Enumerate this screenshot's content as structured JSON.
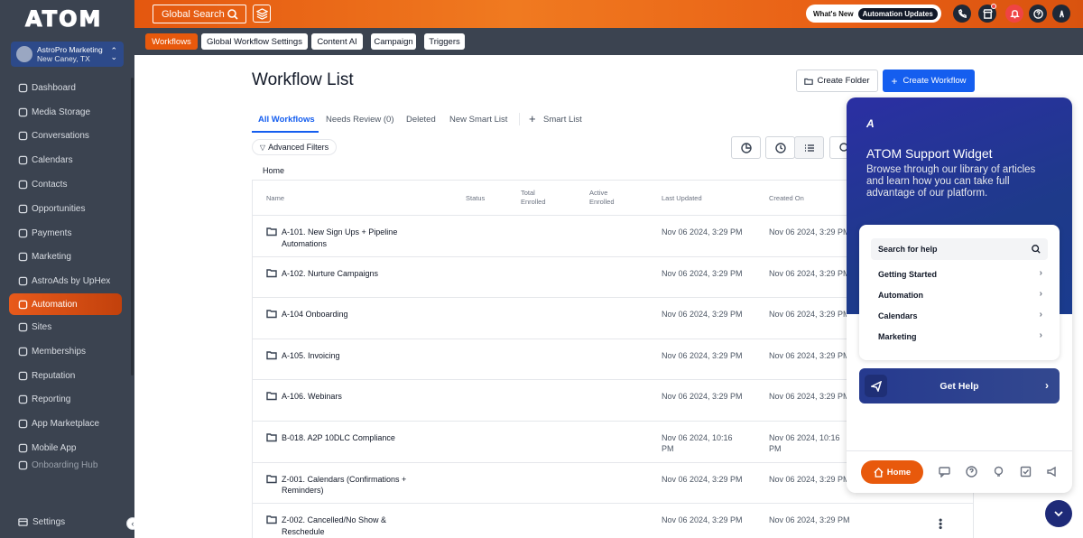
{
  "app": {
    "logo": "ATOM"
  },
  "account": {
    "name": "AstroPro Marketing",
    "location": "New Caney, TX"
  },
  "sidebar": {
    "items": [
      {
        "label": "Dashboard",
        "icon": "dashboard-icon"
      },
      {
        "label": "Media Storage",
        "icon": "media-icon"
      },
      {
        "label": "Conversations",
        "icon": "chat-icon"
      },
      {
        "label": "Calendars",
        "icon": "calendar-icon"
      },
      {
        "label": "Contacts",
        "icon": "contacts-icon"
      },
      {
        "label": "Opportunities",
        "icon": "target-icon"
      },
      {
        "label": "Payments",
        "icon": "dollar-icon"
      },
      {
        "label": "Marketing",
        "icon": "send-icon"
      },
      {
        "label": "AstroAds by UpHex",
        "icon": "ads-icon"
      },
      {
        "label": "Automation",
        "icon": "automation-icon",
        "active": true
      },
      {
        "label": "Sites",
        "icon": "globe-icon"
      },
      {
        "label": "Memberships",
        "icon": "membership-icon"
      },
      {
        "label": "Reputation",
        "icon": "star-icon"
      },
      {
        "label": "Reporting",
        "icon": "report-icon"
      },
      {
        "label": "App Marketplace",
        "icon": "marketplace-icon"
      },
      {
        "label": "Mobile App",
        "icon": "mobile-icon"
      },
      {
        "label": "Onboarding Hub",
        "icon": "onboarding-icon"
      }
    ],
    "settings_label": "Settings"
  },
  "topbar": {
    "search_label": "Global Search",
    "whats_new": "What's New",
    "automation_updates": "Automation Updates"
  },
  "subnav": {
    "tabs": [
      "Workflows",
      "Global Workflow Settings",
      "Content AI",
      "Campaign",
      "Triggers"
    ],
    "active": "Workflows"
  },
  "page": {
    "title": "Workflow List",
    "create_folder": "Create Folder",
    "create_workflow": "Create Workflow",
    "tabs": [
      "All Workflows",
      "Needs Review (0)",
      "Deleted",
      "New Smart List",
      "Smart List"
    ],
    "advanced_filters": "Advanced Filters",
    "breadcrumb": "Home"
  },
  "table": {
    "headers": {
      "name": "Name",
      "status": "Status",
      "total_enrolled": "Total Enrolled",
      "active_enrolled": "Active Enrolled",
      "last_updated": "Last Updated",
      "created_on": "Created On"
    },
    "rows": [
      {
        "name": "A-101. New Sign Ups + Pipeline Automations",
        "updated": "Nov 06 2024, 3:29 PM",
        "created": "Nov 06 2024, 3:29 PM"
      },
      {
        "name": "A-102. Nurture Campaigns",
        "updated": "Nov 06 2024, 3:29 PM",
        "created": "Nov 06 2024, 3:29 PM"
      },
      {
        "name": "A-104 Onboarding",
        "updated": "Nov 06 2024, 3:29 PM",
        "created": "Nov 06 2024, 3:29 PM"
      },
      {
        "name": "A-105. Invoicing",
        "updated": "Nov 06 2024, 3:29 PM",
        "created": "Nov 06 2024, 3:29 PM"
      },
      {
        "name": "A-106. Webinars",
        "updated": "Nov 06 2024, 3:29 PM",
        "created": "Nov 06 2024, 3:29 PM"
      },
      {
        "name": "B-018. A2P 10DLC Compliance",
        "updated": "Nov 06 2024, 10:16 PM",
        "created": "Nov 06 2024, 10:16 PM"
      },
      {
        "name": "Z-001. Calendars (Confirmations + Reminders)",
        "updated": "Nov 06 2024, 3:29 PM",
        "created": "Nov 06 2024, 3:29 PM"
      },
      {
        "name": "Z-002. Cancelled/No Show & Reschedule",
        "updated": "Nov 06 2024, 3:29 PM",
        "created": "Nov 06 2024, 3:29 PM"
      }
    ]
  },
  "widget": {
    "title": "ATOM Support Widget",
    "description": "Browse through our library of articles and learn how you can take full advantage of our platform.",
    "search_placeholder": "Search for help",
    "links": [
      "Getting Started",
      "Automation",
      "Calendars",
      "Marketing"
    ],
    "get_help": "Get Help",
    "home": "Home"
  },
  "colors": {
    "accent": "#e8590c",
    "primary": "#155eef",
    "sidebar": "#3b4350",
    "widget": "#1e3a8a"
  }
}
